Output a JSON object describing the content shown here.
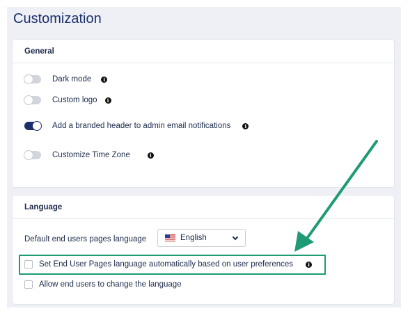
{
  "page": {
    "title": "Customization"
  },
  "general": {
    "header": "General",
    "settings": [
      {
        "label": "Dark mode",
        "enabled": false
      },
      {
        "label": "Custom logo",
        "enabled": false
      },
      {
        "label": "Add a branded header to admin email notifications",
        "enabled": true
      },
      {
        "label": "Customize Time Zone",
        "enabled": false
      }
    ]
  },
  "language": {
    "header": "Language",
    "default_label": "Default end users pages language",
    "select": {
      "value": "English",
      "flag": "us-flag-icon"
    },
    "options": [
      {
        "label": "Set End User Pages language automatically based on user preferences",
        "checked": false,
        "highlighted": true
      },
      {
        "label": "Allow end users to change the language",
        "checked": false
      }
    ]
  },
  "annotation": {
    "color": "#1e9a74"
  },
  "colors": {
    "accent": "#1b2f6b",
    "toggle_off": "#d2d5dc"
  }
}
